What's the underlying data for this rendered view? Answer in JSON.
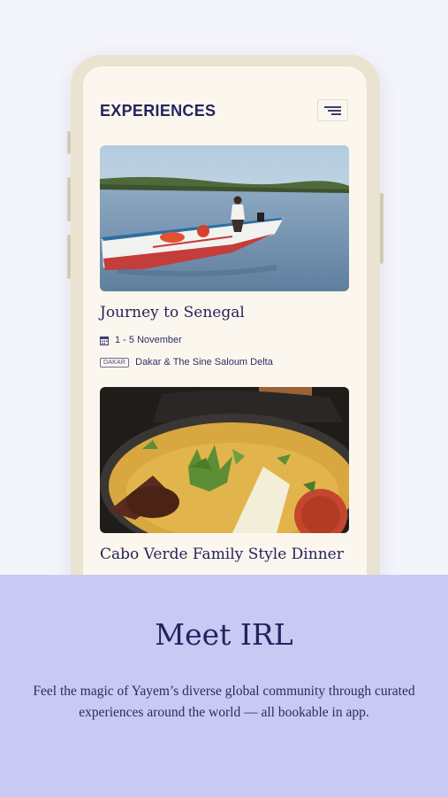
{
  "screen": {
    "title": "EXPERIENCES",
    "menu_icon": "menu-lines-icon"
  },
  "experiences": [
    {
      "title": "Journey to Senegal",
      "date": "1 - 5 November",
      "date_icon": "calendar-icon",
      "location_tag": "DAKAR",
      "location": "Dakar & The Sine Saloum Delta",
      "image": "boat-on-water-photo"
    },
    {
      "title": "Cabo Verde Family Style Dinner",
      "image": "stew-dish-photo"
    }
  ],
  "promo": {
    "headline": "Meet IRL",
    "body": "Feel the magic of Yayem’s diverse global community through curated experiences around the world — all bookable in app."
  },
  "colors": {
    "background": "#f4f4fb",
    "panel": "#c9caf4",
    "navy": "#23245e",
    "screen": "#fcf7ee"
  }
}
